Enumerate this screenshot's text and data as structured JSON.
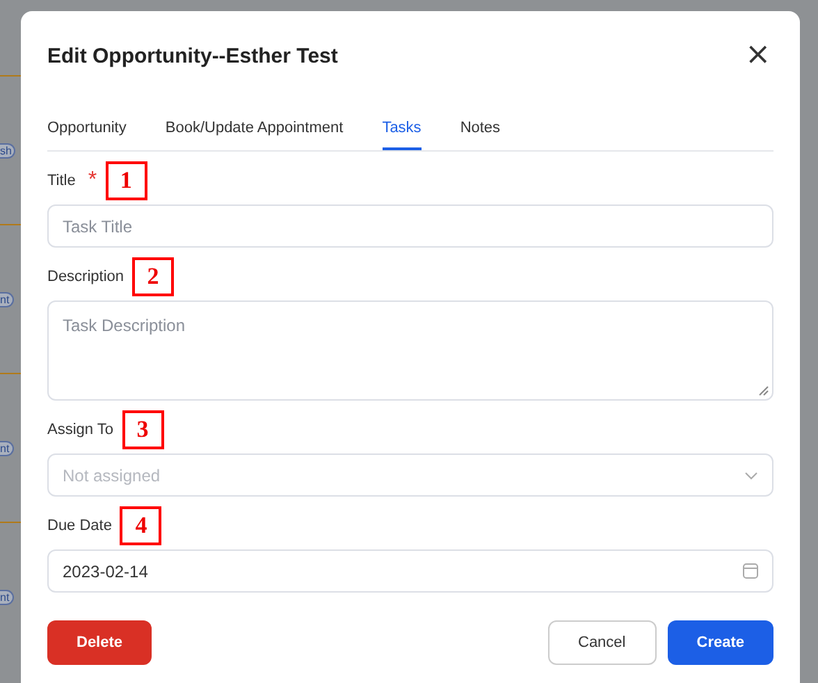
{
  "background": {
    "badges": [
      "sh",
      "nt",
      "nt",
      "nt"
    ]
  },
  "dialog": {
    "title": "Edit Opportunity--Esther Test",
    "close": "×",
    "tabs": [
      {
        "label": "Opportunity",
        "selected": false
      },
      {
        "label": "Book/Update Appointment",
        "selected": false
      },
      {
        "label": "Tasks",
        "selected": true
      },
      {
        "label": "Notes",
        "selected": false
      }
    ],
    "fields": [
      {
        "kind": "text",
        "label": "Title",
        "required_mark": "*",
        "annotation": "1",
        "placeholder": "Task Title"
      },
      {
        "kind": "textarea",
        "label": "Description",
        "annotation": "2",
        "placeholder": "Task Description"
      },
      {
        "kind": "select",
        "label": "Assign To",
        "annotation": "3",
        "placeholder": "Not assigned"
      },
      {
        "kind": "date",
        "label": "Due Date",
        "annotation": "4",
        "value": "2023-02-14"
      }
    ],
    "buttons": {
      "delete": "Delete",
      "cancel": "Cancel",
      "create": "Create"
    }
  }
}
